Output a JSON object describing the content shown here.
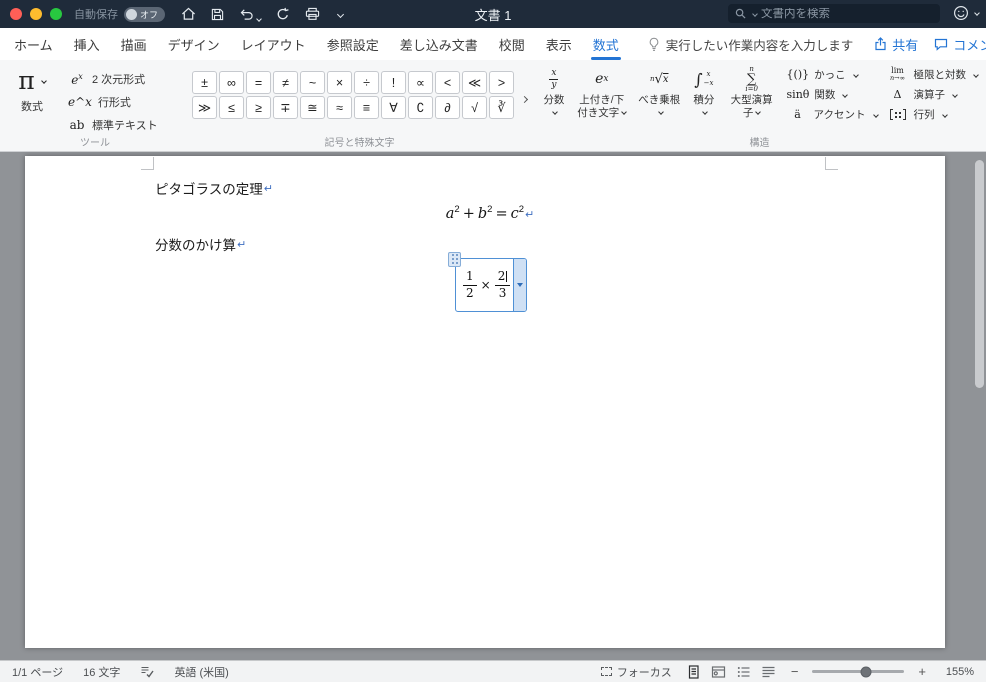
{
  "titlebar": {
    "autosave_label": "自動保存",
    "autosave_state": "オフ",
    "document_title": "文書 1",
    "search_placeholder": "文書内を検索"
  },
  "tabs": {
    "items": [
      "ホーム",
      "挿入",
      "描画",
      "デザイン",
      "レイアウト",
      "参照設定",
      "差し込み文書",
      "校閲",
      "表示",
      "数式"
    ],
    "tell_me": "実行したい作業内容を入力します",
    "share": "共有",
    "comments": "コメント"
  },
  "ribbon": {
    "tools": {
      "group_label": "ツール",
      "pi_icon": "π",
      "equation_button": "数式",
      "professional_base": "e",
      "professional_sup": "x",
      "professional": "2 次元形式",
      "linear_icon": "e^x",
      "linear": "行形式",
      "normal_icon": "ab",
      "normal_text": "標準テキスト"
    },
    "symbols": {
      "group_label": "記号と特殊文字",
      "row1": [
        "±",
        "∞",
        "=",
        "≠",
        "~",
        "×",
        "÷",
        "!",
        "∝",
        "<",
        "≪",
        ">"
      ],
      "row2": [
        "≫",
        "≤",
        "≥",
        "∓",
        "≅",
        "≈",
        "≡",
        "∀",
        "∁",
        "∂",
        "√",
        "∛"
      ]
    },
    "structures": {
      "group_label": "構造",
      "fraction": {
        "label": "分数",
        "num": "x",
        "den": "y"
      },
      "script": {
        "label": "上付き/下付き文字",
        "base": "e",
        "sup": "x"
      },
      "radical": {
        "label": "べき乗根",
        "index": "n",
        "sign": "√",
        "radicand": "x"
      },
      "integral": {
        "label": "積分",
        "sign": "∫",
        "sup": "x",
        "sub": "−x"
      },
      "large_operator": {
        "label": "大型演算子",
        "top": "n",
        "sign": "∑",
        "bottom": "i=0"
      },
      "bracket": {
        "label": "かっこ",
        "icon": "{()}"
      },
      "function": {
        "label": "関数",
        "icon": "sinθ"
      },
      "accent": {
        "label": "アクセント",
        "icon": "ä"
      },
      "limit": {
        "label": "極限と対数",
        "top": "lim",
        "bottom": "n→∞"
      },
      "operator": {
        "label": "演算子",
        "icon": "Δ"
      },
      "matrix": {
        "label": "行列"
      }
    }
  },
  "document": {
    "heading1": "ピタゴラスの定理",
    "heading2": "分数のかけ算",
    "paragraph_mark": "↵",
    "equation1": {
      "a": "a",
      "a_exp": "2",
      "plus": "+",
      "b": "b",
      "b_exp": "2",
      "equals": "=",
      "c": "c",
      "c_exp": "2"
    },
    "equation2": {
      "num1": "1",
      "den1": "2",
      "times": "×",
      "num2": "2",
      "den2": "3",
      "equals": "="
    }
  },
  "statusbar": {
    "page": "1/1 ページ",
    "words": "16 文字",
    "language": "英語 (米国)",
    "focus": "フォーカス",
    "zoom_out": "−",
    "zoom_in": "+",
    "zoom": "155%"
  }
}
